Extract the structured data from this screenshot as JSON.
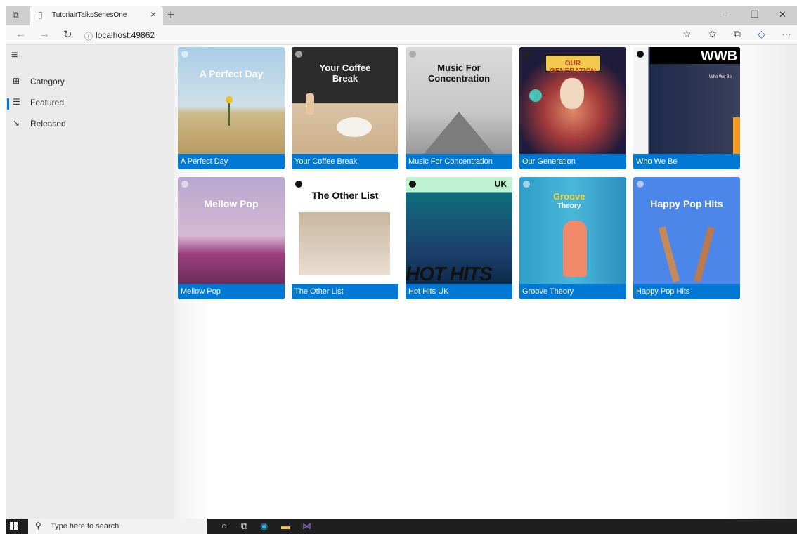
{
  "browser": {
    "tab_title": "TutorialrTalksSeriesOne",
    "url": "localhost:49862"
  },
  "sidebar": {
    "items": [
      {
        "label": "Category",
        "icon": "category-grid-icon"
      },
      {
        "label": "Featured",
        "icon": "featured-list-icon"
      },
      {
        "label": "Released",
        "icon": "released-icon"
      }
    ],
    "active": "Featured"
  },
  "playlists": [
    {
      "caption": "A Perfect Day",
      "cover_title": "A Perfect Day"
    },
    {
      "caption": "Your Coffee Break",
      "cover_title": "Your Coffee Break"
    },
    {
      "caption": "Music For Concentration",
      "cover_title": "Music For Concentration"
    },
    {
      "caption": "Our Generation",
      "cover_title": "OUR GENERATION"
    },
    {
      "caption": "Who We Be",
      "cover_title": "WWB",
      "cover_subtitle": "Who We Be"
    },
    {
      "caption": "Mellow Pop",
      "cover_title": "Mellow Pop"
    },
    {
      "caption": "The Other List",
      "cover_title": "The Other List"
    },
    {
      "caption": "Hot Hits UK",
      "cover_title": "HOT HITS",
      "cover_badge": "UK"
    },
    {
      "caption": "Groove Theory",
      "cover_title": "Groove",
      "cover_subtitle": "Theory"
    },
    {
      "caption": "Happy Pop Hits",
      "cover_title": "Happy Pop Hits"
    }
  ],
  "taskbar": {
    "search_placeholder": "Type here to search"
  },
  "colors": {
    "accent": "#0078d4",
    "taskbar": "#1f1f1f",
    "sidebar": "#ebebeb"
  }
}
